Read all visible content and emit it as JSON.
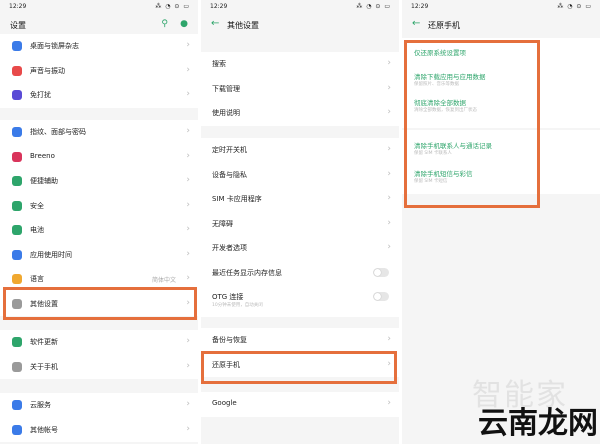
{
  "status": {
    "time": "12:29",
    "icons": "⁂ ◔ ⊙ ▭"
  },
  "panel1": {
    "title": "设置",
    "items": [
      {
        "label": "桌面与锁屏杂志",
        "color": "#3b7be8"
      },
      {
        "label": "声音与振动",
        "color": "#e84a4a"
      },
      {
        "label": "免打扰",
        "color": "#5a4bd6"
      },
      {
        "label": "指纹、面部与密码",
        "color": "#3b7be8"
      },
      {
        "label": "Breeno",
        "color": "#d9345b"
      },
      {
        "label": "便捷辅助",
        "color": "#2ea56b"
      },
      {
        "label": "安全",
        "color": "#2ea56b"
      },
      {
        "label": "电池",
        "color": "#2ea56b"
      },
      {
        "label": "应用使用时间",
        "color": "#3b7be8"
      },
      {
        "label": "语言",
        "value": "简体中文",
        "color": "#f0a830"
      },
      {
        "label": "其他设置",
        "color": "#9a9a9a"
      },
      {
        "label": "软件更新",
        "color": "#2ea56b"
      },
      {
        "label": "关于手机",
        "color": "#9a9a9a"
      },
      {
        "label": "云服务",
        "color": "#3b7be8"
      },
      {
        "label": "其他帐号",
        "color": "#3b7be8"
      }
    ]
  },
  "panel2": {
    "title": "其他设置",
    "items": [
      {
        "label": "搜索"
      },
      {
        "label": "下载管理"
      },
      {
        "label": "使用说明"
      },
      {
        "label": "定时开关机"
      },
      {
        "label": "设备与隐私"
      },
      {
        "label": "SIM 卡应用程序"
      },
      {
        "label": "无障碍"
      },
      {
        "label": "开发者选项"
      },
      {
        "label": "最近任务显示内存信息"
      },
      {
        "label": "OTG 连接",
        "sub": "10分钟未使用，自动关闭"
      },
      {
        "label": "备份与恢复"
      },
      {
        "label": "还原手机"
      },
      {
        "label": "Google"
      }
    ]
  },
  "panel3": {
    "title": "还原手机",
    "items": [
      {
        "label": "仅还原系统设置项",
        "sub": ""
      },
      {
        "label": "清除下载应用与应用数据",
        "sub": "保留照片、音乐等数据"
      },
      {
        "label": "彻底清除全部数据",
        "sub": "清除全部数据，恢复到出厂状态"
      },
      {
        "label": "清除手机联系人与通话记录",
        "sub": "保留 SIM 卡联系人"
      },
      {
        "label": "清除手机短信与彩信",
        "sub": "保留 SIM 卡短信"
      }
    ]
  },
  "watermark": {
    "top": "智能家",
    "bottom": "云南龙网"
  }
}
